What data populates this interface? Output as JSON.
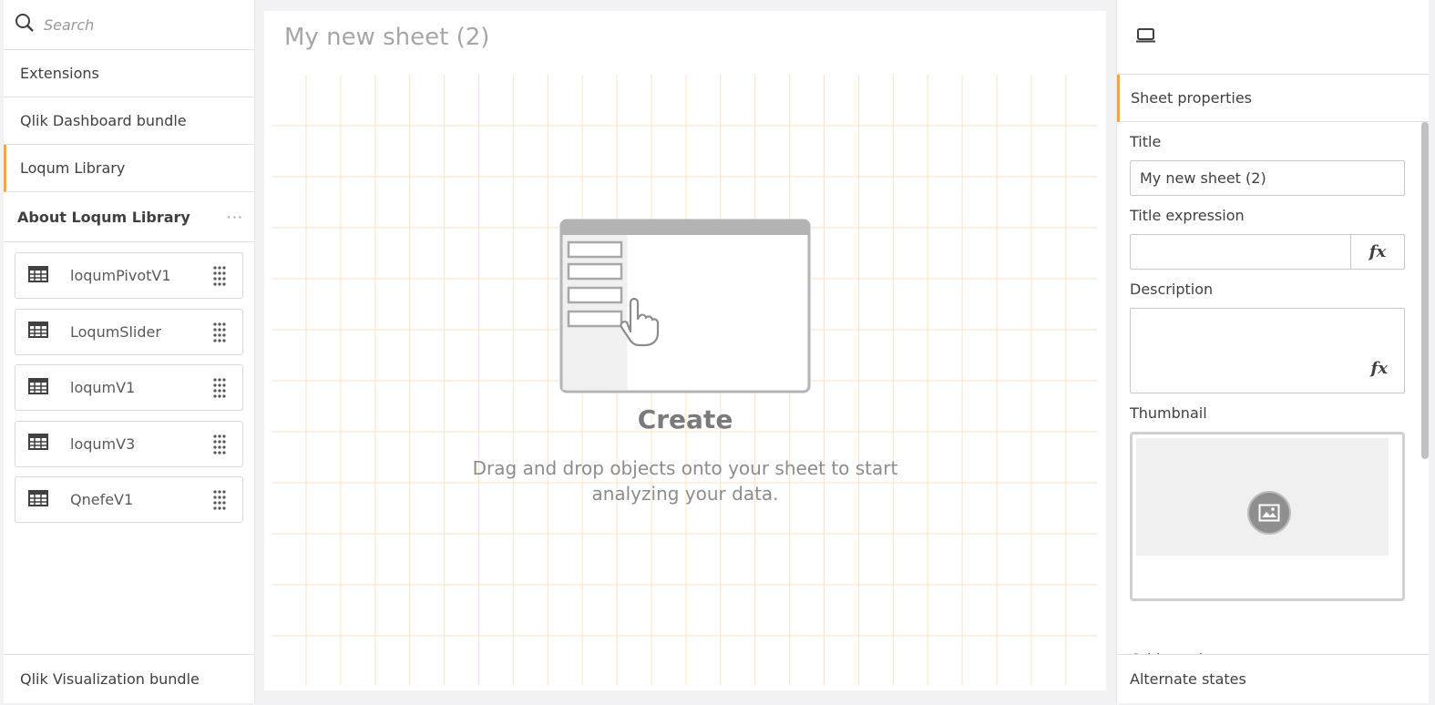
{
  "left_panel": {
    "search_placeholder": "Search",
    "libraries": [
      "Extensions",
      "Qlik Dashboard bundle",
      "Loqum Library"
    ],
    "about_title": "About Loqum Library",
    "more": "···",
    "items": [
      "loqumPivotV1",
      "LoqumSlider",
      "loqumV1",
      "loqumV3",
      "QnefeV1"
    ],
    "bottom_library": "Qlik Visualization bundle"
  },
  "sheet": {
    "title": "My new sheet (2)",
    "create_title": "Create",
    "create_desc": "Drag and drop objects onto your sheet to start analyzing your data."
  },
  "right_panel": {
    "section": "Sheet properties",
    "title_label": "Title",
    "title_value": "My new sheet (2)",
    "title_expr_label": "Title expression",
    "fx": "fx",
    "description_label": "Description",
    "thumbnail_label": "Thumbnail",
    "partial_label": "Grid spacing",
    "alternate_states": "Alternate states"
  },
  "colors": {
    "accent": "#f0a54a",
    "grid": "#fde3c4"
  }
}
